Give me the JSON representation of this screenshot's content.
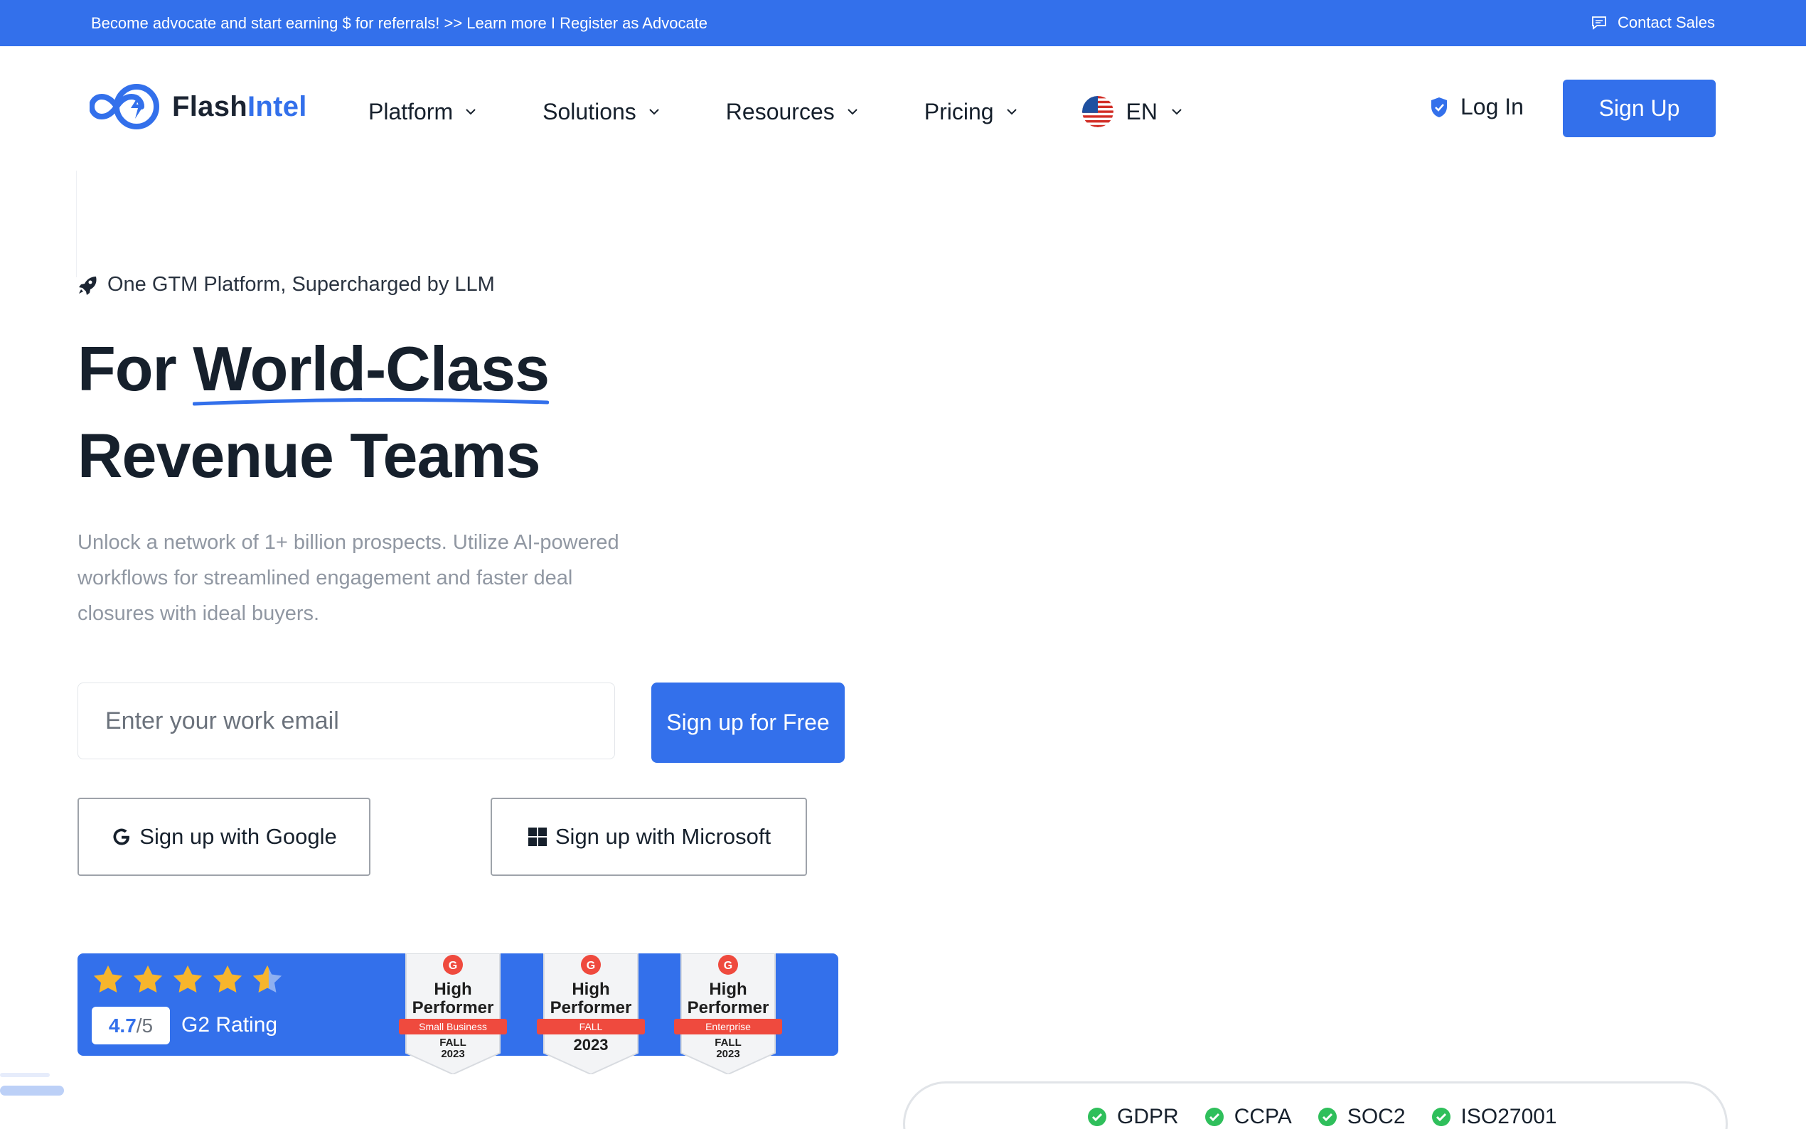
{
  "topbar": {
    "promo": "Become advocate and start earning $ for referrals! >> Learn more I Register as Advocate",
    "contact": "Contact Sales",
    "contact_icon": "chat-icon"
  },
  "brand": {
    "name_part1": "Flash",
    "name_part2": "Intel",
    "accent": "#3370eb"
  },
  "nav": {
    "items": [
      {
        "label": "Platform"
      },
      {
        "label": "Solutions"
      },
      {
        "label": "Resources"
      },
      {
        "label": "Pricing"
      }
    ],
    "language": "EN",
    "login": "Log In",
    "signup": "Sign Up"
  },
  "hero": {
    "tagline": "One GTM Platform, Supercharged by LLM",
    "headline_part1": "For ",
    "headline_highlight": "World-Class",
    "headline_line2": "Revenue Teams",
    "description": "Unlock a network of 1+ billion prospects. Utilize AI-powered workflows for streamlined engagement and faster deal closures with ideal buyers.",
    "email_placeholder": "Enter your work email",
    "cta": "Sign up for Free",
    "google": "Sign up with Google",
    "microsoft": "Sign up with Microsoft"
  },
  "rating": {
    "stars": 4.5,
    "value": "4.7",
    "out_of": "/5",
    "label": "G2 Rating",
    "badges": [
      {
        "title1": "High",
        "title2": "Performer",
        "ribbon": "Small Business",
        "season1": "FALL",
        "season2": "2023"
      },
      {
        "title1": "High",
        "title2": "Performer",
        "ribbon": "FALL",
        "season1": "2023",
        "season2": ""
      },
      {
        "title1": "High",
        "title2": "Performer",
        "ribbon": "Enterprise",
        "season1": "FALL",
        "season2": "2023"
      }
    ]
  },
  "compliance": [
    "GDPR",
    "CCPA",
    "SOC2",
    "ISO27001"
  ]
}
